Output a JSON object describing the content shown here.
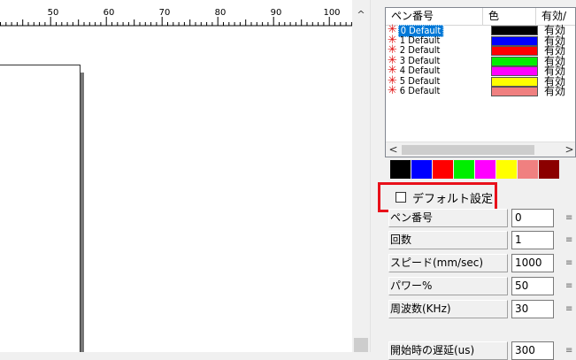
{
  "ruler": {
    "labels": [
      "50",
      "60",
      "70",
      "80",
      "90",
      "100"
    ]
  },
  "scroll_up_icon": "chevron-up-icon",
  "pen_table": {
    "headers": {
      "pen_no": "ペン番号",
      "color": "色",
      "valid": "有効/"
    },
    "rows": [
      {
        "name": "0 Default",
        "color": "#000000",
        "valid": "有効",
        "selected": true
      },
      {
        "name": "1 Default",
        "color": "#0000ff",
        "valid": "有効",
        "selected": false
      },
      {
        "name": "2 Default",
        "color": "#ff0000",
        "valid": "有効",
        "selected": false
      },
      {
        "name": "3 Default",
        "color": "#00ee00",
        "valid": "有効",
        "selected": false
      },
      {
        "name": "4 Default",
        "color": "#ff00ff",
        "valid": "有効",
        "selected": false
      },
      {
        "name": "5 Default",
        "color": "#ffff00",
        "valid": "有効",
        "selected": false
      },
      {
        "name": "6 Default",
        "color": "#f08080",
        "valid": "有効",
        "selected": false
      }
    ],
    "scroll_left": "<",
    "scroll_right": ">"
  },
  "palette": [
    "#000000",
    "#0000ff",
    "#ff0000",
    "#00ee00",
    "#ff00ff",
    "#ffff00",
    "#f08080",
    "#8b0000"
  ],
  "default_setting": {
    "label": "デフォルト設定",
    "checked": false,
    "highlight_color": "#e8101a"
  },
  "params": [
    {
      "label": "ペン番号",
      "value": "0"
    },
    {
      "label": "回数",
      "value": "1"
    },
    {
      "label": "スピード(mm/sec)",
      "value": "1000"
    },
    {
      "label": "パワー%",
      "value": "50"
    },
    {
      "label": "周波数(KHz)",
      "value": "30"
    }
  ],
  "partial_row": {
    "label": "開始時の遅延(us)",
    "value": "300"
  }
}
